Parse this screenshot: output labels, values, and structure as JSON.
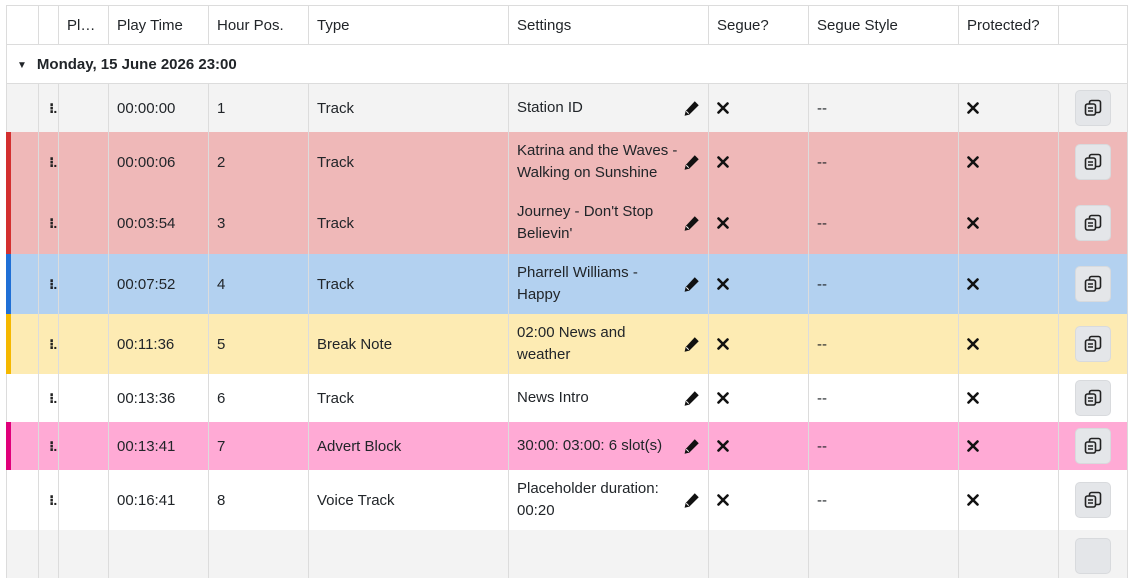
{
  "headers": [
    "",
    "",
    "Play Time",
    "Play Time",
    "Hour Pos.",
    "Type",
    "Settings",
    "Segue?",
    "Segue Style",
    "Protected?",
    ""
  ],
  "columns": {
    "play": "Pla...",
    "play_time": "Play Time",
    "hour_pos": "Hour Pos.",
    "type": "Type",
    "settings": "Settings",
    "segue": "Segue?",
    "segue_style": "Segue Style",
    "protected": "Protected?"
  },
  "group": {
    "label": "Monday, 15 June 2026 23:00"
  },
  "handle_glyph": "⁝.",
  "colors": {
    "red": "#efb8b8",
    "red_bar": "#d32f2f",
    "blue": "#b3d1f0",
    "blue_bar": "#1f6fd6",
    "yellow": "#fdebb3",
    "yellow_bar": "#f5b800",
    "pink": "#ffaad5",
    "pink_bar": "#e0007a",
    "grey": "#f3f3f3"
  },
  "rows": [
    {
      "play_time": "00:00:00",
      "hour_pos": "1",
      "type": "Track",
      "settings": "Station ID",
      "segue_style": "--",
      "color": "grey",
      "segue": "x-mark-icon",
      "protected": "x-mark-icon"
    },
    {
      "play_time": "00:00:06",
      "hour_pos": "2",
      "type": "Track",
      "settings": "Katrina and the Waves - Walking on Sunshine",
      "segue_style": "--",
      "color": "red",
      "segue": "x-mark-icon",
      "protected": "x-mark-icon"
    },
    {
      "play_time": "00:03:54",
      "hour_pos": "3",
      "type": "Track",
      "settings": "Journey - Don't Stop Believin'",
      "segue_style": "--",
      "color": "red",
      "segue": "x-mark-icon",
      "protected": "x-mark-icon"
    },
    {
      "play_time": "00:07:52",
      "hour_pos": "4",
      "type": "Track",
      "settings": "Pharrell Williams - Happy",
      "segue_style": "--",
      "color": "blue",
      "segue": "x-mark-icon",
      "protected": "x-mark-icon"
    },
    {
      "play_time": "00:11:36",
      "hour_pos": "5",
      "type": "Break Note",
      "settings": "02:00 News and weather",
      "segue_style": "--",
      "color": "yellow",
      "segue": "x-mark-icon",
      "protected": "x-mark-icon"
    },
    {
      "play_time": "00:13:36",
      "hour_pos": "6",
      "type": "Track",
      "settings": "News Intro",
      "segue_style": "--",
      "color": "white",
      "segue": "x-mark-icon",
      "protected": "x-mark-icon"
    },
    {
      "play_time": "00:13:41",
      "hour_pos": "7",
      "type": "Advert Block",
      "settings": "30:00: 03:00: 6 slot(s)",
      "segue_style": "--",
      "color": "pink",
      "segue": "x-mark-icon",
      "protected": "x-mark-icon"
    },
    {
      "play_time": "00:16:41",
      "hour_pos": "8",
      "type": "Voice Track",
      "settings": "Placeholder duration: 00:20",
      "segue_style": "--",
      "color": "white",
      "segue": "x-mark-icon",
      "protected": "x-mark-icon"
    }
  ]
}
